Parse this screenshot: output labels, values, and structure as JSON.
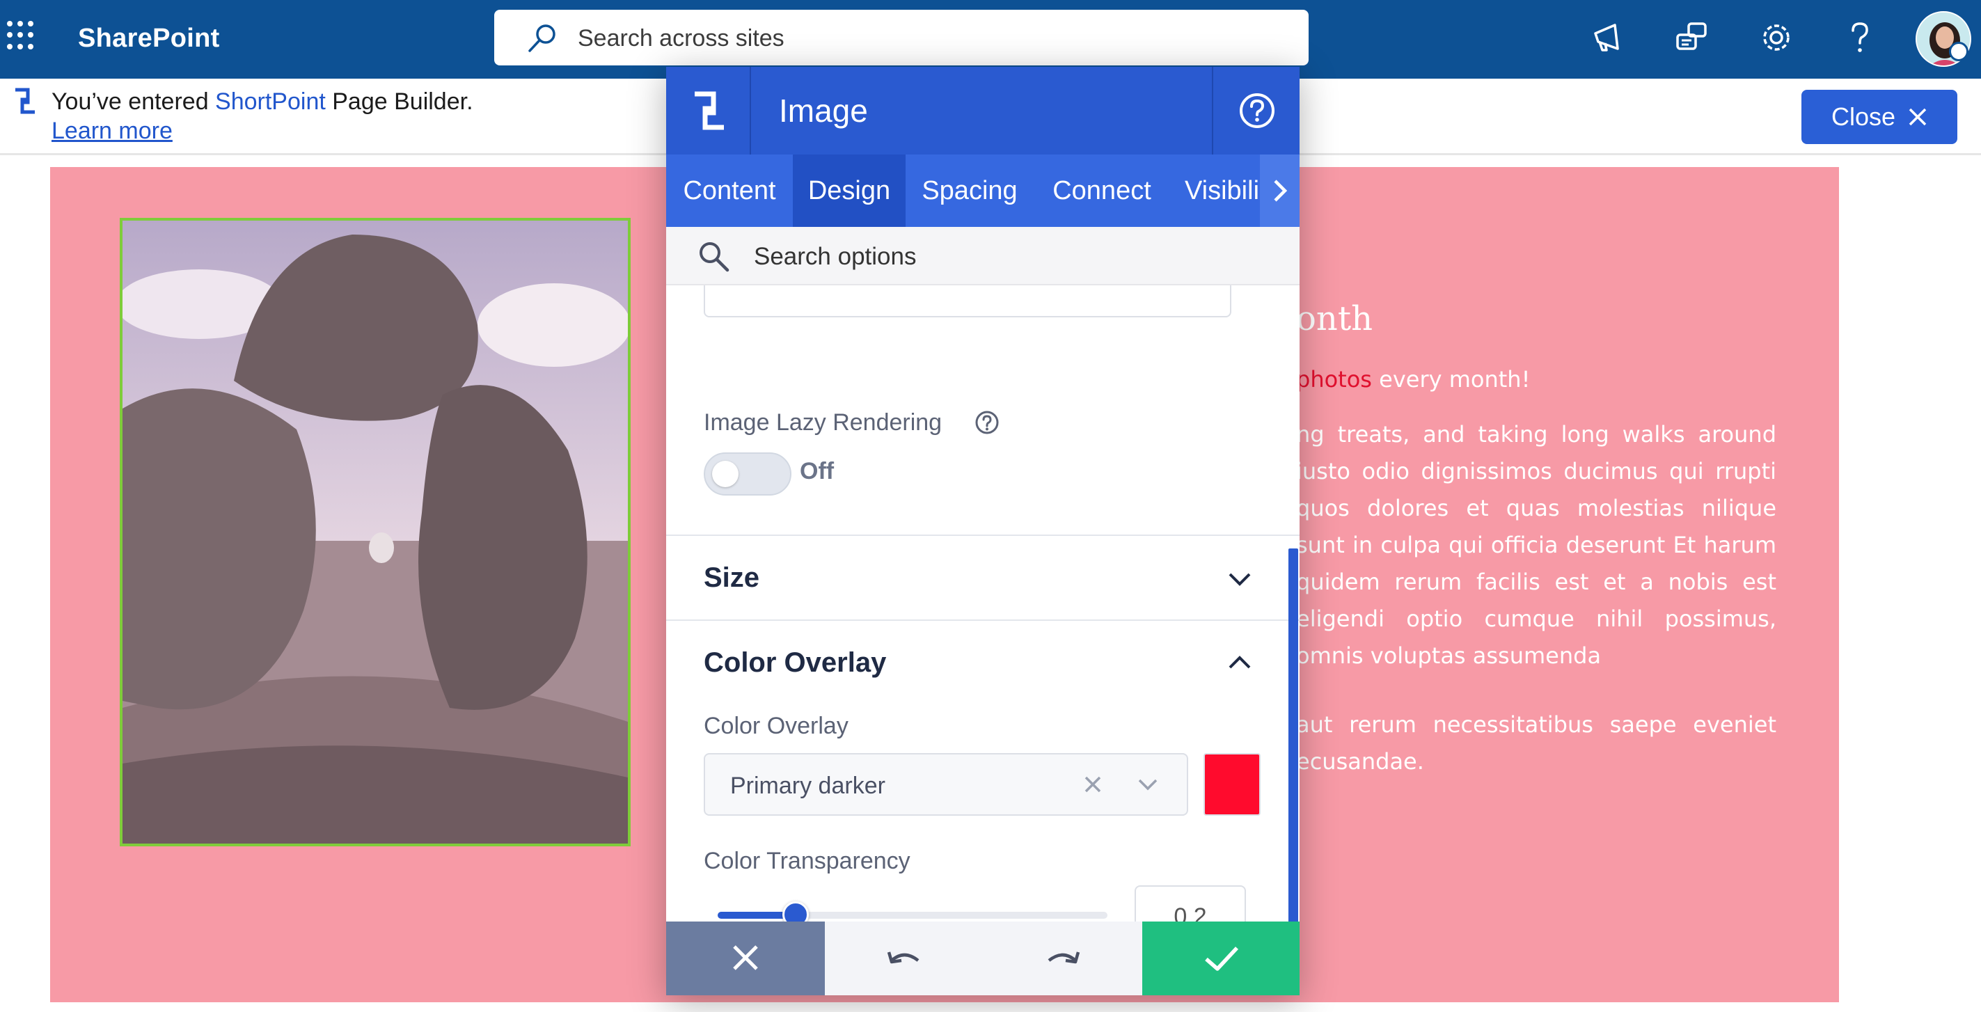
{
  "suitebar": {
    "app_name": "SharePoint",
    "search_placeholder": "Search across sites"
  },
  "builder": {
    "msg_prefix": "You’ve entered ",
    "product": "ShortPoint",
    "msg_suffix": " Page Builder. ",
    "learn_more": "Learn more",
    "close_label": "Close"
  },
  "page": {
    "title_fragment": "onth",
    "subtitle_highlight": "photos",
    "subtitle_rest": " every month!",
    "para1": "ng treats, and taking long walks around iusto odio dignissimos ducimus qui rrupti quos dolores et quas molestias nilique sunt in culpa qui officia deserunt Et harum quidem rerum facilis est et a nobis est eligendi optio cumque nihil possimus, omnis voluptas assumenda",
    "para2": "aut rerum necessitatibus saepe eveniet ecusandae."
  },
  "panel": {
    "title": "Image",
    "tabs": [
      "Content",
      "Design",
      "Spacing",
      "Connect",
      "Visibili"
    ],
    "active_tab": "Design",
    "search_placeholder": "Search options",
    "lazy_label": "Image Lazy Rendering",
    "lazy_state": "Off",
    "size_title": "Size",
    "overlay_title": "Color Overlay",
    "overlay_label": "Color Overlay",
    "overlay_value": "Primary darker",
    "overlay_color": "#ff0b2d",
    "transparency_label": "Color Transparency",
    "transparency_value": "0.2",
    "transparency_fraction": 0.2
  },
  "colors": {
    "suitebar": "#0d5194",
    "accent": "#2a5ad0",
    "canvas_bg": "#f79aa6",
    "confirm": "#1fbf80",
    "cancel": "#6b7ca0"
  }
}
